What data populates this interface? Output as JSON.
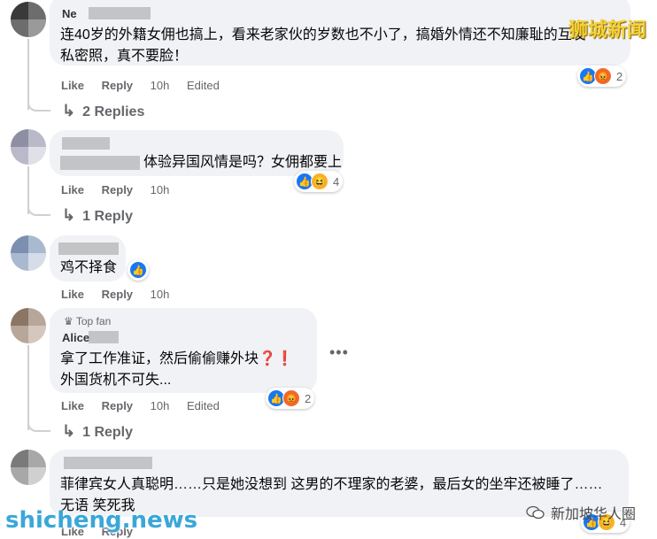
{
  "watermark": {
    "top_right": "狮城新闻",
    "bottom_left": "shicheng.news",
    "bottom_right": "新加坡华人圈"
  },
  "actions": {
    "like": "Like",
    "reply": "Reply"
  },
  "comments": [
    {
      "author": "Ne",
      "line1": "连40岁的外籍女佣也搞上，看来老家伙的岁数也不小了，搞婚外情还不知廉耻的互发",
      "line2": "私密照，真不要脸！",
      "time": "10h",
      "edited": "Edited",
      "reaction_count": "2",
      "reactions": [
        "like-icon",
        "angry-icon"
      ],
      "replies": "2 Replies"
    },
    {
      "author": "",
      "line1": "体验异国风情是吗？女佣都要上",
      "time": "10h",
      "reaction_count": "4",
      "reactions": [
        "like-icon",
        "haha-icon"
      ],
      "replies": "1 Reply"
    },
    {
      "author": "",
      "line1": "鸡不择食",
      "time": "10h",
      "reactions": [
        "like-icon"
      ]
    },
    {
      "badge": "Top fan",
      "author": "Alice",
      "line1": "拿了工作准证，然后偷偷赚外块❓❗",
      "line2": "外国货机不可失...",
      "time": "10h",
      "edited": "Edited",
      "reaction_count": "2",
      "reactions": [
        "like-icon",
        "angry-icon"
      ],
      "replies": "1 Reply",
      "more": "•••"
    },
    {
      "author": "",
      "line1": "菲律宾女人真聪明……只是她没想到 这男的不理家的老婆，最后女的坐牢还被睡了……",
      "line2": "无语 笑死我",
      "time": "",
      "reaction_count": "4",
      "reactions": [
        "like-icon",
        "haha-icon"
      ]
    }
  ]
}
